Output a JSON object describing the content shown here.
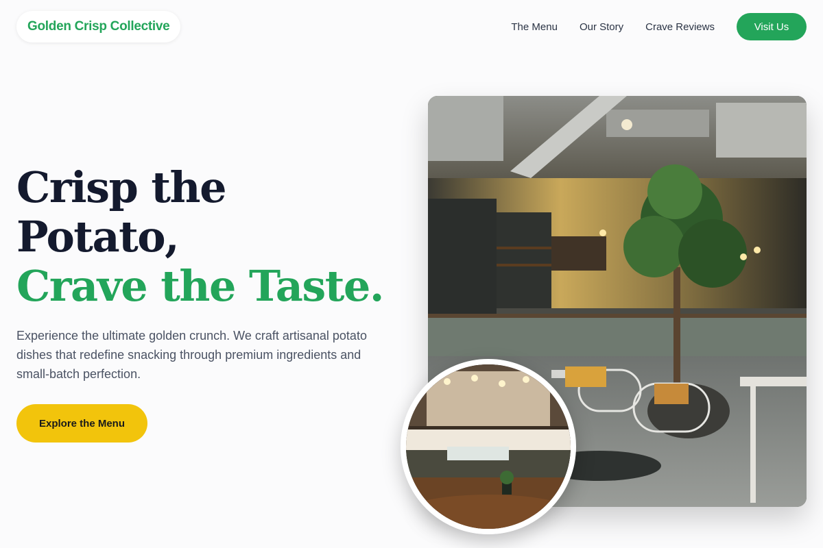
{
  "brand": {
    "name": "Golden Crisp Collective"
  },
  "nav": {
    "links": [
      "The Menu",
      "Our Story",
      "Crave Reviews"
    ],
    "cta": "Visit Us"
  },
  "hero": {
    "title_line1": "Crisp the",
    "title_line2": "Potato,",
    "title_line3": "Crave the Taste.",
    "description": "Experience the ultimate golden crunch. We craft artisanal potato dishes that redefine snacking through premium ingredients and small-batch perfection.",
    "cta": "Explore the Menu"
  },
  "colors": {
    "accent_green": "#23a55a",
    "accent_yellow": "#f2c40c",
    "heading_dark": "#141a2e"
  },
  "images": {
    "main_photo_icon": "cafe-interior-image",
    "inset_photo_icon": "cafe-counter-image"
  }
}
